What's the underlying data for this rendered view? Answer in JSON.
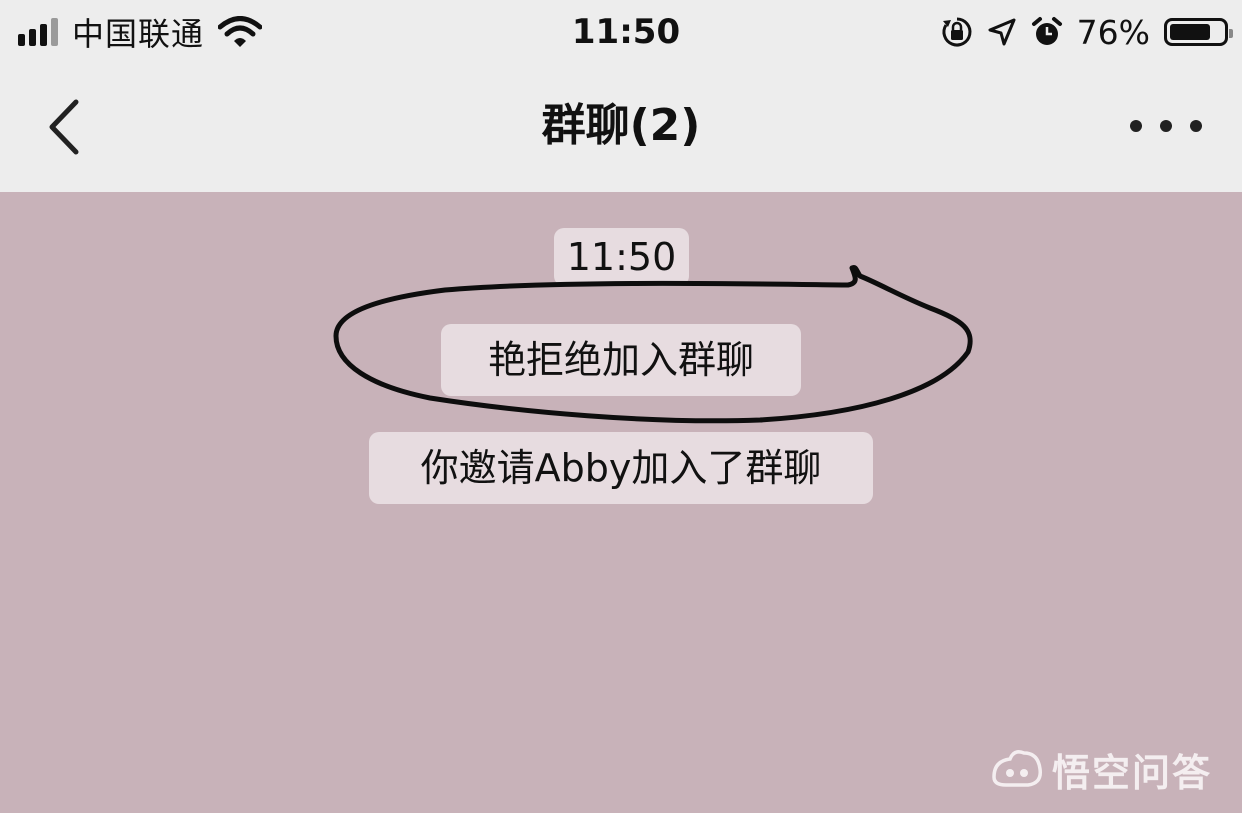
{
  "status_bar": {
    "carrier": "中国联通",
    "time": "11:50",
    "battery_percent": "76%",
    "battery_level": 0.76,
    "icons": [
      "signal-icon",
      "wifi-icon",
      "orientation-lock-icon",
      "location-icon",
      "alarm-icon",
      "battery-icon"
    ]
  },
  "nav": {
    "title": "群聊(2)",
    "back_icon": "chevron-left-icon",
    "more_icon": "more-dots-icon"
  },
  "chat": {
    "background_color": "#c8b2b9",
    "timestamp": "11:50",
    "system_messages": [
      "艳拒绝加入群聊",
      "你邀请Abby加入了群聊"
    ]
  },
  "watermark": {
    "text": "悟空问答",
    "icon": "wukong-logo-icon"
  }
}
